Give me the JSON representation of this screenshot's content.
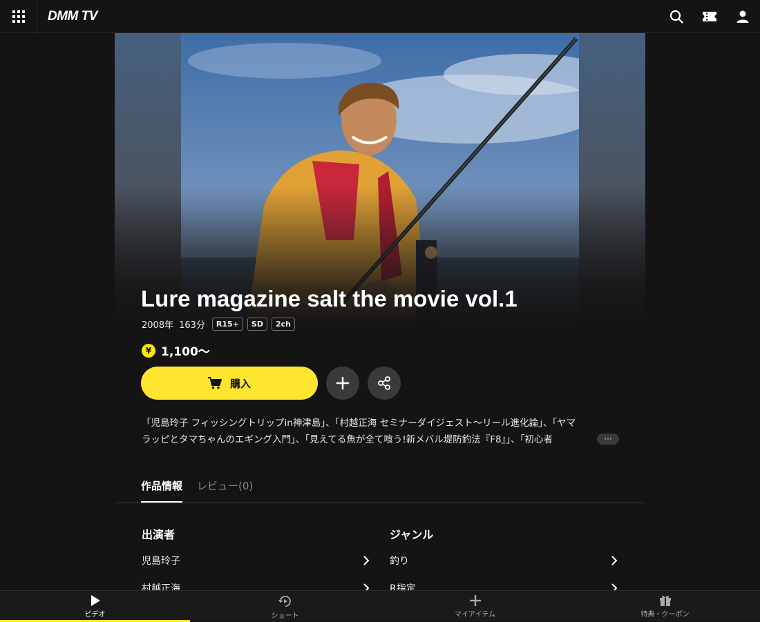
{
  "header": {
    "logo": "DMM TV",
    "icons": [
      "grid-menu-icon",
      "search-icon",
      "ticket-icon",
      "user-icon"
    ]
  },
  "hero": {
    "title": "Lure magazine salt the movie vol.1"
  },
  "meta": {
    "year": "2008年",
    "duration": "163分",
    "badges": [
      "R15+",
      "SD",
      "2ch"
    ]
  },
  "price": {
    "symbol": "¥",
    "text": "1,100〜"
  },
  "actions": {
    "buy_label": "購入"
  },
  "description": {
    "line1": "「児島玲子 フィッシングトリップin神津島」、「村越正海 セミナーダイジェスト〜リール進化論」、「ヤマ",
    "line2": "ラッピとタマちゃんのエギング入門」、「見えてる魚が全て喰う!新メバル堤防釣法『F8』」、「初心者",
    "more": "···"
  },
  "tabs": [
    {
      "label": "作品情報"
    },
    {
      "label": "レビュー(0)"
    }
  ],
  "details": {
    "cast_heading": "出演者",
    "cast": [
      "児島玲子",
      "村越正海"
    ],
    "genre_heading": "ジャンル",
    "genres": [
      "釣り",
      "R指定"
    ]
  },
  "bottom_nav": [
    {
      "label": "ビデオ",
      "icon": "play-icon"
    },
    {
      "label": "ショート",
      "icon": "short-icon"
    },
    {
      "label": "マイアイテム",
      "icon": "plus-icon"
    },
    {
      "label": "特典・クーポン",
      "icon": "gift-icon"
    }
  ],
  "colors": {
    "accent": "#ffe62e",
    "background": "#141414"
  }
}
